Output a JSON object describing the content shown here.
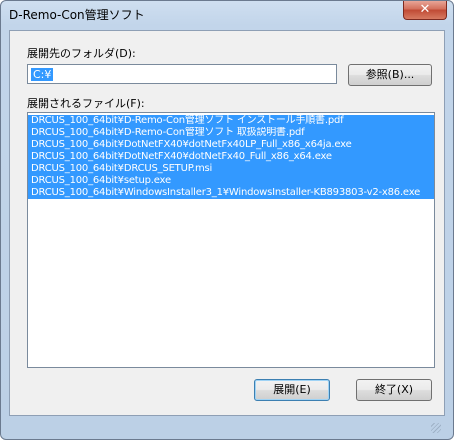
{
  "window": {
    "title": "D-Remo-Con管理ソフト",
    "close_glyph": "✕"
  },
  "folder": {
    "label": "展開先のフォルダ(D):",
    "value": "C:¥",
    "browse_label": "参照(B)..."
  },
  "files": {
    "label": "展開されるファイル(F):",
    "items": [
      "DRCUS_100_64bit¥D-Remo-Con管理ソフト インストール手順書.pdf",
      "DRCUS_100_64bit¥D-Remo-Con管理ソフト 取扱説明書.pdf",
      "DRCUS_100_64bit¥DotNetFX40¥dotNetFx40LP_Full_x86_x64ja.exe",
      "DRCUS_100_64bit¥DotNetFX40¥dotNetFx40_Full_x86_x64.exe",
      "DRCUS_100_64bit¥DRCUS_SETUP.msi",
      "DRCUS_100_64bit¥setup.exe",
      "DRCUS_100_64bit¥WindowsInstaller3_1¥WindowsInstaller-KB893803-v2-x86.exe"
    ]
  },
  "buttons": {
    "extract_label": "展開(E)",
    "exit_label": "終了(X)"
  },
  "colors": {
    "selection": "#3399ff",
    "close": "#c04a34"
  }
}
